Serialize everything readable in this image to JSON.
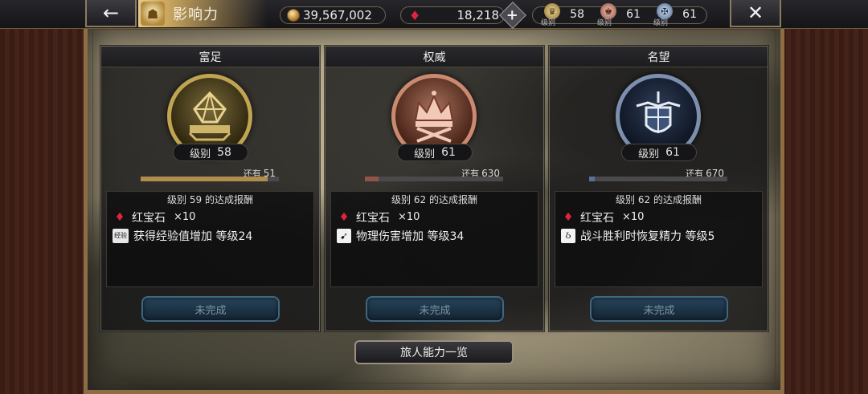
{
  "header": {
    "title": "影响力",
    "gold": "39,567,002",
    "rubies": "18,218",
    "influence_levels": [
      {
        "caption": "级别",
        "value": "58",
        "icon": "wealth-crest-icon"
      },
      {
        "caption": "级别",
        "value": "61",
        "icon": "power-crest-icon"
      },
      {
        "caption": "级别",
        "value": "61",
        "icon": "fame-crest-icon"
      }
    ]
  },
  "cards": [
    {
      "title": "富足",
      "level_label": "级别",
      "level": "58",
      "remain_label": "还有",
      "remain": "51",
      "progress": 0.92,
      "reward_title": "级别 59 的达成报酬",
      "reward_item": "红宝石",
      "reward_qty": "×10",
      "reward_bonus_tag": "经验",
      "reward_bonus": "获得经验值增加 等级24",
      "status": "未完成"
    },
    {
      "title": "权威",
      "level_label": "级别",
      "level": "61",
      "remain_label": "还有",
      "remain": "630",
      "progress": 0.1,
      "reward_title": "级别 62 的达成报酬",
      "reward_item": "红宝石",
      "reward_qty": "×10",
      "reward_bonus": "物理伤害增加 等级34",
      "status": "未完成"
    },
    {
      "title": "名望",
      "level_label": "级别",
      "level": "61",
      "remain_label": "还有",
      "remain": "670",
      "progress": 0.04,
      "reward_title": "级别 62 的达成报酬",
      "reward_item": "红宝石",
      "reward_qty": "×10",
      "reward_bonus": "战斗胜利时恢复精力 等级5",
      "status": "未完成"
    }
  ],
  "footer": {
    "button": "旅人能力一览"
  },
  "colors": {
    "wealth": "#c0a452",
    "power": "#c98a70",
    "fame": "#7d8fae",
    "ruby": "#e1233f"
  }
}
